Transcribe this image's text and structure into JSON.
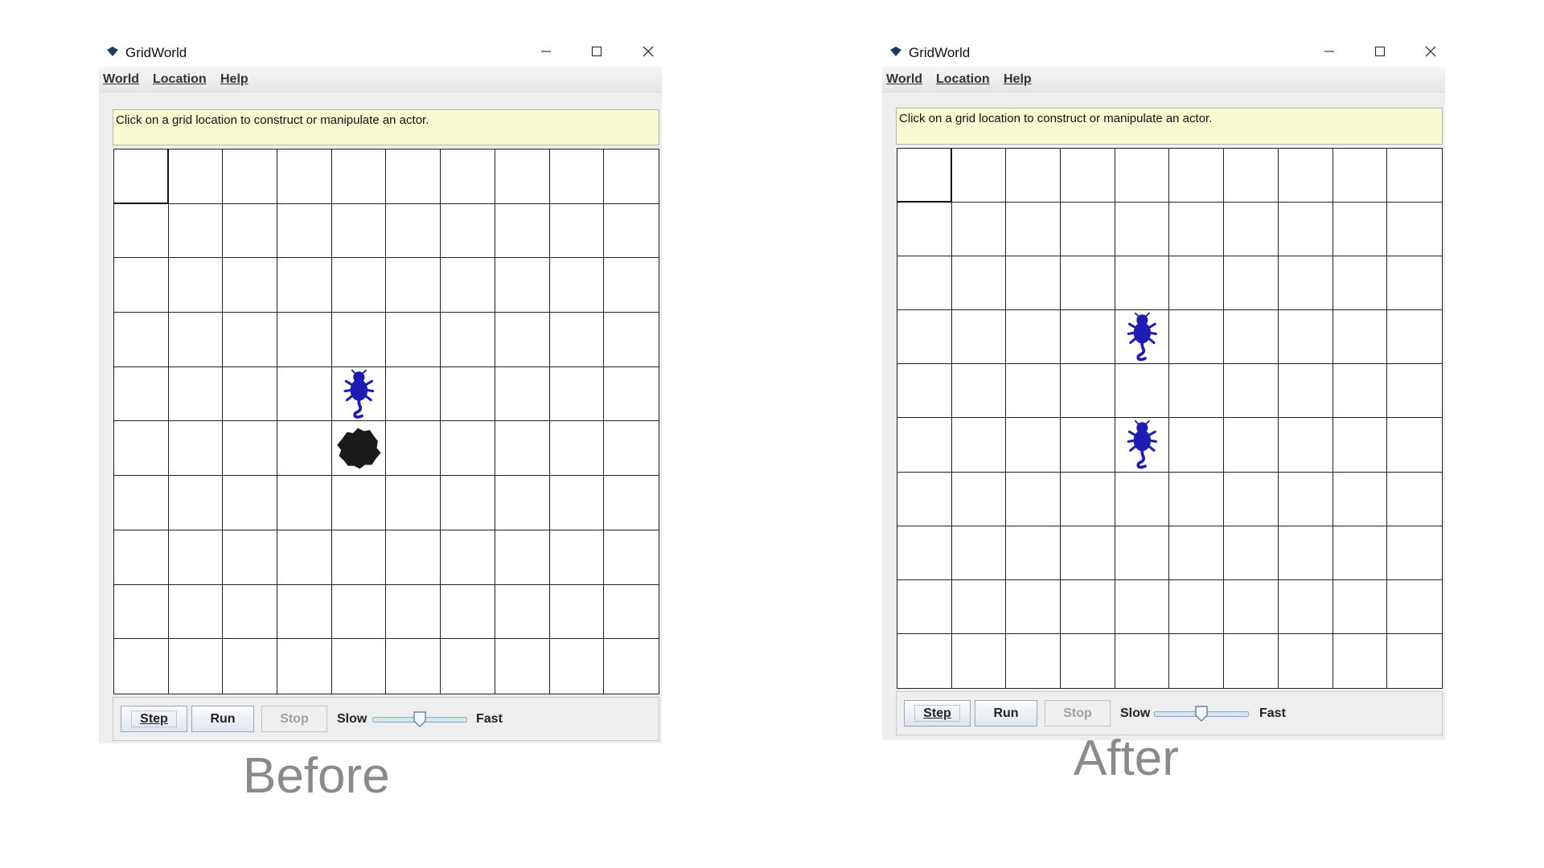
{
  "panels": [
    {
      "id": "before",
      "window_title": "GridWorld",
      "menus": [
        "World",
        "Location",
        "Help"
      ],
      "message": "Click on a grid location to construct or manipulate an actor.",
      "grid": {
        "rows": 10,
        "cols": 10,
        "selected": [
          0,
          0
        ],
        "actors": [
          {
            "kind": "bug",
            "row": 4,
            "col": 4,
            "color": "#1d1db4"
          },
          {
            "kind": "rock",
            "row": 5,
            "col": 4,
            "color": "#1a1a1a"
          }
        ]
      },
      "controls": {
        "step": "Step",
        "run": "Run",
        "stop": "Stop",
        "slow": "Slow",
        "fast": "Fast",
        "speed": 0.5
      },
      "caption": "Before"
    },
    {
      "id": "after",
      "window_title": "GridWorld",
      "menus": [
        "World",
        "Location",
        "Help"
      ],
      "message": "Click on a grid location to construct or manipulate an actor.",
      "grid": {
        "rows": 10,
        "cols": 10,
        "selected": [
          0,
          0
        ],
        "actors": [
          {
            "kind": "bug",
            "row": 3,
            "col": 4,
            "color": "#1d1db4"
          },
          {
            "kind": "bug",
            "row": 5,
            "col": 4,
            "color": "#1d1db4"
          }
        ]
      },
      "controls": {
        "step": "Step",
        "run": "Run",
        "stop": "Stop",
        "slow": "Slow",
        "fast": "Fast",
        "speed": 0.5
      },
      "caption": "After"
    }
  ]
}
